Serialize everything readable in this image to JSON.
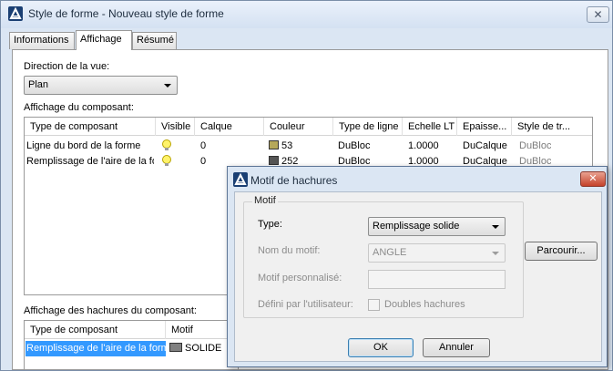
{
  "window": {
    "title": "Style de forme - Nouveau style de forme",
    "close_glyph": "✕"
  },
  "tabs": [
    {
      "label": "Informations"
    },
    {
      "label": "Affichage",
      "active": true
    },
    {
      "label": "Résumé"
    }
  ],
  "view": {
    "direction_label": "Direction de la vue:",
    "direction_value": "Plan"
  },
  "component_display": {
    "label": "Affichage du composant:",
    "columns": [
      "Type de composant",
      "Visible",
      "Calque",
      "Couleur",
      "Type de ligne",
      "Echelle LT",
      "Epaisse...",
      "Style de tr..."
    ],
    "rows": [
      {
        "type": "Ligne du bord de la forme",
        "calque": "0",
        "couleur": "53",
        "swatch": "#b5a85a",
        "type_ligne": "DuBloc",
        "echelle": "1.0000",
        "epaisseur": "DuCalque",
        "style": "DuBloc"
      },
      {
        "type": "Remplissage de l'aire de la for",
        "calque": "0",
        "couleur": "252",
        "swatch": "#555555",
        "type_ligne": "DuBloc",
        "echelle": "1.0000",
        "epaisseur": "DuCalque",
        "style": "DuBloc"
      }
    ]
  },
  "hatch_display": {
    "label": "Affichage des hachures du composant:",
    "columns": [
      "Type de composant",
      "Motif"
    ],
    "rows": [
      {
        "type": "Remplissage de l'aire de la forme",
        "motif": "SOLIDE",
        "swatch": "#808080"
      }
    ]
  },
  "dialog": {
    "title": "Motif de hachures",
    "close_glyph": "✕",
    "group_title": "Motif",
    "type_label": "Type:",
    "type_value": "Remplissage solide",
    "pattern_name_label": "Nom du motif:",
    "pattern_name_value": "ANGLE",
    "custom_pattern_label": "Motif personnalisé:",
    "user_defined_label": "Défini par l'utilisateur:",
    "double_hatch_label": "Doubles hachures",
    "browse_label": "Parcourir...",
    "ok_label": "OK",
    "cancel_label": "Annuler"
  },
  "colors": {
    "accent": "#3399ff",
    "selection": "#3399ff",
    "window_frame": "#dbe6f3",
    "dialog_close": "#c4412a"
  },
  "icons": {
    "app": "autocad-logo-icon",
    "visible": "lightbulb-icon"
  }
}
